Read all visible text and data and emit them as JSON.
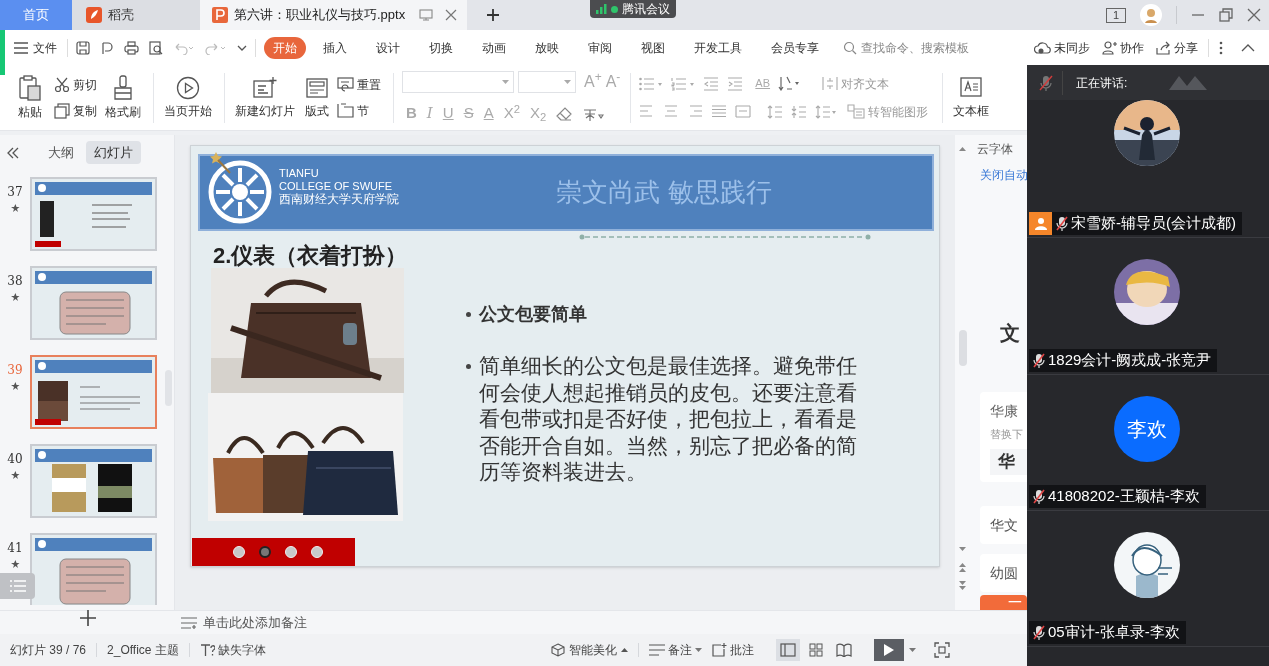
{
  "tabs": [
    {
      "label": "首页",
      "kind": "home",
      "selected": false
    },
    {
      "label": "稻壳",
      "kind": "docer",
      "selected": false
    },
    {
      "label": "第六讲：职业礼仪与技巧.pptx",
      "kind": "document",
      "selected": true
    }
  ],
  "meeting_app": {
    "label": "腾讯会议"
  },
  "window_badge": "1",
  "menu": {
    "file": "文件",
    "ribbon_tabs": [
      {
        "label": "开始",
        "selected": true
      },
      {
        "label": "插入",
        "selected": false
      },
      {
        "label": "设计",
        "selected": false
      },
      {
        "label": "切换",
        "selected": false
      },
      {
        "label": "动画",
        "selected": false
      },
      {
        "label": "放映",
        "selected": false
      },
      {
        "label": "审阅",
        "selected": false
      },
      {
        "label": "视图",
        "selected": false
      },
      {
        "label": "开发工具",
        "selected": false
      },
      {
        "label": "会员专享",
        "selected": false
      }
    ],
    "search": {
      "placeholder": "查找命令、搜索模板"
    },
    "sync": "未同步",
    "collaborate": "协作",
    "share": "分享"
  },
  "ribbon": {
    "paste": "粘贴",
    "cut": "剪切",
    "copy": "复制",
    "format_painter": "格式刷",
    "play_current": "当页开始",
    "new_slide": "新建幻灯片",
    "layout": "版式",
    "reset": "重置",
    "section": "节",
    "align_text": "对齐文本",
    "smart_art": "转智能图形",
    "text_box": "文本框",
    "font_buttons": [
      "B",
      "I",
      "U",
      "S",
      "A",
      "X$^{2}$",
      "X$_{2}$"
    ],
    "grow_font": "A$^{+}$",
    "shrink_font": "A$^{-}$",
    "char_spacing": "AB"
  },
  "panel_tabs": [
    {
      "label": "大纲",
      "selected": false
    },
    {
      "label": "幻灯片",
      "selected": true
    }
  ],
  "slides": [
    {
      "number": "37",
      "selected": false
    },
    {
      "number": "38",
      "selected": false
    },
    {
      "number": "39",
      "selected": true
    },
    {
      "number": "40",
      "selected": false
    },
    {
      "number": "41",
      "selected": false
    }
  ],
  "slide": {
    "school_en_1": "TIANFU",
    "school_en_2": "COLLEGE OF SWUFE",
    "school_cn": "西南财经大学天府学院",
    "motto": "崇文尚武 敏思践行",
    "title": "2.仪表（衣着打扮）",
    "bullets": [
      {
        "text": "公文包要简单",
        "bold": true
      },
      {
        "text": "简单细长的公文包是最佳选择。避免带任何会使人想起推销员的皮包。还要注意看看包带或扣是否好使，把包拉上，看看是否能开合自如。当然，别忘了把必备的简历等资料装进去。",
        "bold": false
      }
    ],
    "nav_dots": [
      {
        "selected": false
      },
      {
        "selected": true
      },
      {
        "selected": false
      },
      {
        "selected": false
      }
    ]
  },
  "font_panel": {
    "cloud_fonts": "云字体",
    "auto_close": "关闭自动",
    "heading": "文",
    "font_1": "华康",
    "replace": "替换下",
    "font_1_sample": "华",
    "font_2": "华文",
    "font_3": "幼圆",
    "apply": "一"
  },
  "notes": {
    "placeholder": "单击此处添加备注"
  },
  "status_bar": {
    "position": "幻灯片 39 / 76",
    "theme": "2_Office 主题",
    "missing_fonts": "缺失字体",
    "beautify": "智能美化",
    "notes": "备注",
    "comments": "批注",
    "views": [
      {
        "selected": true
      },
      {
        "selected": false
      },
      {
        "selected": false
      }
    ]
  },
  "meeting": {
    "speaking_label": "正在讲话:",
    "participants": [
      {
        "name": "宋雪娇-辅导员(会计成都)",
        "host": true,
        "muted": true
      },
      {
        "name": "1829会计-阙戎成-张竞尹",
        "host": false,
        "muted": true
      },
      {
        "name": "41808202-王颖桔-李欢",
        "initials": "李欢",
        "host": false,
        "muted": true
      },
      {
        "name": "05审计-张卓录-李欢",
        "host": false,
        "muted": true
      }
    ]
  }
}
